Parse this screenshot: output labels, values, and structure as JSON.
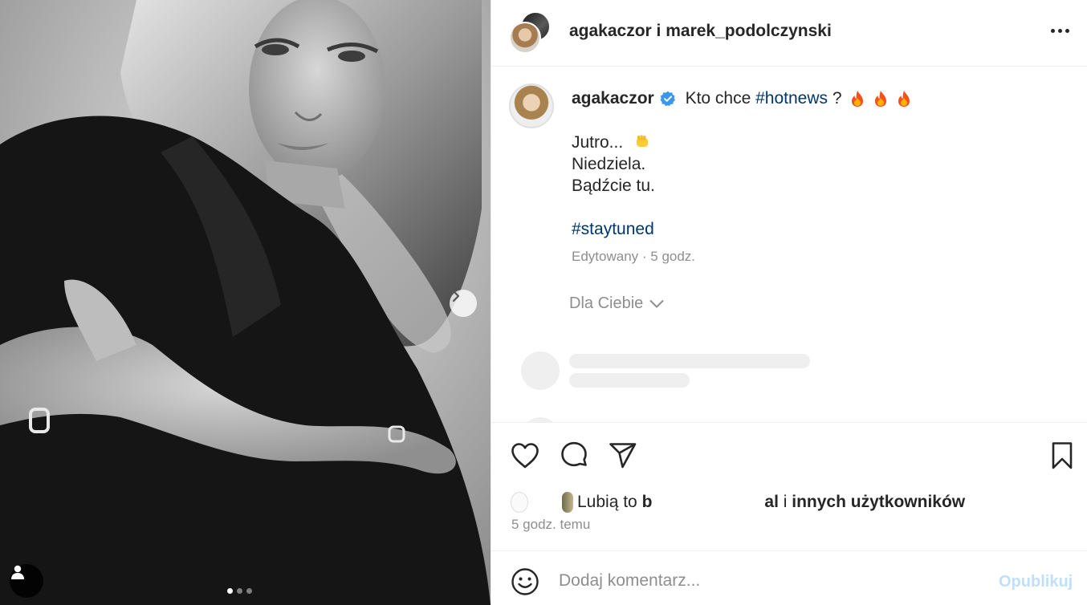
{
  "post": {
    "header_title": "agakaczor i marek_podolczynski",
    "caption": {
      "username": "agakaczor",
      "text_before_tag": " Kto chce ",
      "hashtag_main": "#hotnews",
      "text_after_tag": " ?",
      "line1": "Jutro...",
      "line2": "Niedziela.",
      "line3": "Bądźcie tu.",
      "hashtag_stay": "#staytuned",
      "edited": "Edytowany · 5 godz."
    },
    "for_you": "Dla Ciebie",
    "likes": {
      "prefix": "Lubią to ",
      "user_start": "b",
      "user_end": "al",
      "suffix_join": " i ",
      "suffix_bold": "innych użytkowników"
    },
    "time": "5 godz. temu",
    "comment": {
      "placeholder": "Dodaj komentarz...",
      "publish_label": "Opublikuj"
    }
  },
  "carousel": {
    "total": 3,
    "active_index": 0
  },
  "colors": {
    "hashtag": "#00376b",
    "verified": "#3897f0",
    "publish_disabled": "#c0dffd",
    "muted": "#8e8e8e"
  },
  "icons": [
    "chevron-right-icon",
    "user-tag-icon",
    "more-icon",
    "verified-icon",
    "fire-icon",
    "fist-icon",
    "chevron-down-icon",
    "heart-icon",
    "comment-icon",
    "share-icon",
    "bookmark-icon",
    "emoji-icon"
  ]
}
